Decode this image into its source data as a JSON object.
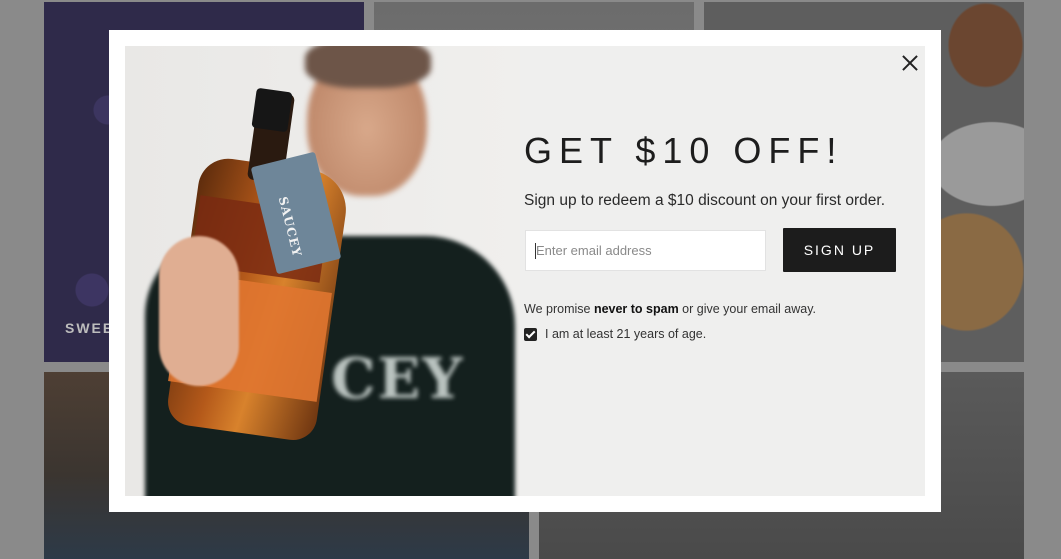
{
  "background": {
    "tile_label": "SWEE"
  },
  "modal": {
    "headline": "GET $10 OFF!",
    "subline": "Sign up to redeem a $10 discount on your first order.",
    "email_placeholder": "Enter email address",
    "email_value": "",
    "signup_label": "SIGN UP",
    "promise_prefix": "We promise ",
    "promise_bold": "never to spam",
    "promise_suffix": " or give your email away.",
    "age_label": "I am at least 21 years of age.",
    "age_checked": true,
    "close_icon": "close-icon"
  },
  "photo": {
    "tag_text": "SAUCEY",
    "shirt_text": "CEY"
  }
}
